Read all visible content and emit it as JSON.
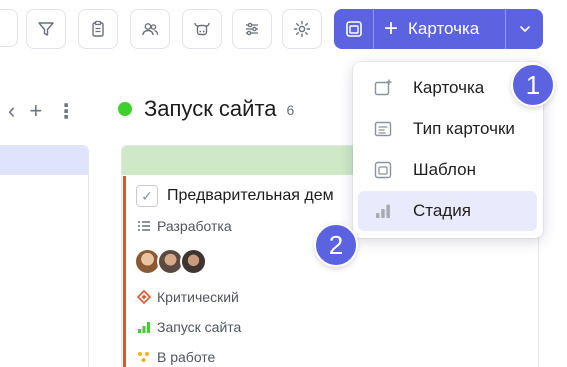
{
  "toolbar": {
    "filter_icon": "filter-icon",
    "clipboard_icon": "clipboard-icon",
    "users_icon": "users-icon",
    "bull_icon": "bull-icon",
    "sliders_icon": "sliders-icon",
    "settings_icon": "gear-icon",
    "template_icon": "template-icon",
    "add_button": {
      "plus": "+",
      "label": "Карточка"
    },
    "dropdown_icon": "chevron-down-icon"
  },
  "left_column": {
    "controls": {
      "chevron": "‹",
      "plus": "+",
      "more": "⋮"
    }
  },
  "column": {
    "name": "Запуск сайта",
    "count": "6",
    "status_color": "#3ed12a",
    "band_color": "#cfe8c7"
  },
  "card": {
    "title": "Предварительная дем",
    "type": "Разработка",
    "priority": "Критический",
    "stage": "Запуск сайта",
    "status": "В работе",
    "border_color": "#e0552e"
  },
  "dropdown": {
    "items": [
      {
        "label": "Карточка",
        "icon": "card-add-icon",
        "active": false
      },
      {
        "label": "Тип карточки",
        "icon": "card-type-icon",
        "active": false
      },
      {
        "label": "Шаблон",
        "icon": "template-icon",
        "active": false
      },
      {
        "label": "Стадия",
        "icon": "stage-bars-icon",
        "active": true
      }
    ]
  },
  "badges": [
    "1",
    "2"
  ],
  "colors": {
    "accent": "#5b63e0",
    "active_bg": "#e9ebfc"
  }
}
